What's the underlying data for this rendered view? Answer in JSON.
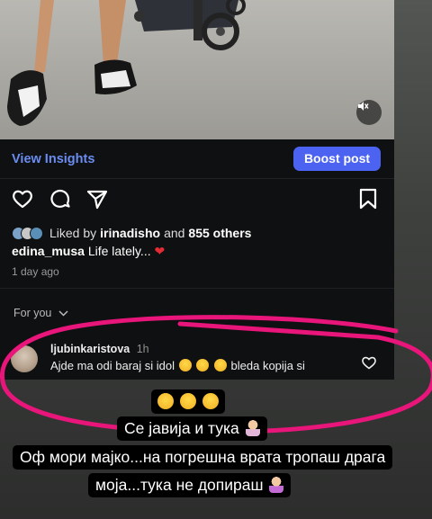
{
  "post": {
    "view_insights_label": "View Insights",
    "boost_label": "Boost post",
    "liked_prefix": "Liked by",
    "liked_user": "irinadisho",
    "liked_and": "and",
    "liked_others": "855 others",
    "caption_user": "edina_musa",
    "caption_text": "Life lately...",
    "date": "1 day ago",
    "for_you_label": "For you"
  },
  "comment": {
    "username": "ljubinkaristova",
    "time": "1h",
    "text_before": "Ajde ma odi baraj si idol",
    "text_after": "bleda kopija si"
  },
  "story_text": {
    "line2": "Се јавија и тука",
    "line3": "Оф мори мајко...на погрешна врата тропаш драга",
    "line4": "моја...тука не допираш"
  },
  "colors": {
    "accent_link": "#6b8cf0",
    "boost_button": "#4b63f0",
    "highlight_ellipse": "#e8157a"
  },
  "icons": [
    "mute-icon",
    "heart-icon",
    "comment-icon",
    "share-icon",
    "bookmark-icon",
    "chevron-down-icon",
    "laughing-emoji",
    "woman-tipping-hand-emoji",
    "woman-shrugging-emoji",
    "red-heart-emoji"
  ]
}
